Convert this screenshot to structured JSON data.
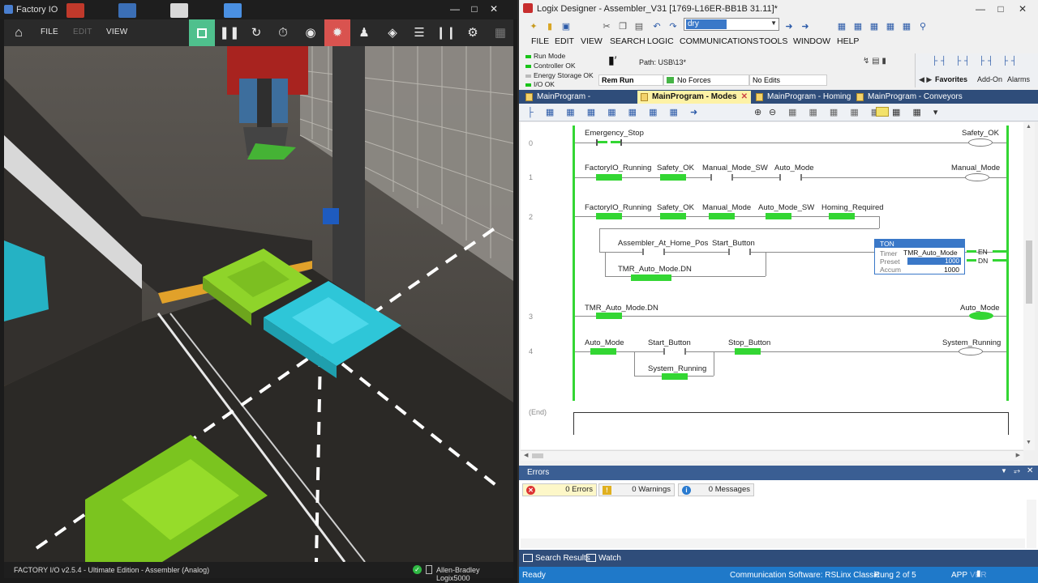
{
  "factory_io": {
    "window_title": "Factory IO",
    "menu": {
      "file": "FILE",
      "edit": "EDIT",
      "view": "VIEW"
    },
    "status_text": "FACTORY I/O v2.5.4 - Ultimate Edition - Assembler (Analog)",
    "driver_label": "Allen-Bradley Logix5000",
    "icons": [
      "home-icon",
      "edit-mode-icon",
      "pause-icon",
      "reset-icon",
      "timer-icon",
      "camera-icon",
      "sensors-icon",
      "person-icon",
      "target-icon",
      "list-icon",
      "signal-icon",
      "gears-icon",
      "grid-icon"
    ],
    "colors": {
      "accent_green": "#4fc08d",
      "accent_red": "#d9534f",
      "conveyor_yellow": "#e5a522",
      "tray_cyan": "#2ec6d8",
      "tray_green": "#8fd42a"
    }
  },
  "logix": {
    "window_title": "Logix Designer - Assembler_V31 [1769-L16ER-BB1B 31.11]*",
    "search_combo_value": "dry",
    "menu": [
      "FILE",
      "EDIT",
      "VIEW",
      "SEARCH",
      "LOGIC",
      "COMMUNICATIONS",
      "TOOLS",
      "WINDOW",
      "HELP"
    ],
    "controller_status": [
      "Run Mode",
      "Controller OK",
      "Energy Storage OK",
      "I/O OK"
    ],
    "path_label": "Path: USB\\13*",
    "mode": "Rem Run",
    "forces": "No Forces",
    "edits": "No Edits",
    "palette_tabs": [
      "Favorites",
      "Add-On",
      "Alarms"
    ],
    "tabs": [
      {
        "label": "MainProgram - Sequence_A*",
        "active": false
      },
      {
        "label": "MainProgram - Modes",
        "active": true
      },
      {
        "label": "MainProgram - Homing",
        "active": false
      },
      {
        "label": "MainProgram - Conveyors",
        "active": false
      }
    ],
    "rungs": [
      {
        "num": "0",
        "tags": [
          "Emergency_Stop"
        ],
        "coil": "Safety_OK"
      },
      {
        "num": "1",
        "tags": [
          "FactoryIO_Running",
          "Safety_OK",
          "Manual_Mode_SW",
          "Auto_Mode"
        ],
        "coil": "Manual_Mode"
      },
      {
        "num": "2",
        "tags": [
          "FactoryIO_Running",
          "Safety_OK",
          "Manual_Mode",
          "Auto_Mode_SW",
          "Homing_Required"
        ],
        "branch_tags": [
          "Assembler_At_Home_Pos",
          "Start_Button",
          "TMR_Auto_Mode.DN"
        ],
        "ton": {
          "title": "TON",
          "timer_label": "Timer",
          "timer_value": "TMR_Auto_Mode",
          "preset_label": "Preset",
          "preset_value": "1000",
          "accum_label": "Accum",
          "accum_value": "1000",
          "en": "EN",
          "dn": "DN"
        }
      },
      {
        "num": "3",
        "tags": [
          "TMR_Auto_Mode.DN"
        ],
        "coil": "Auto_Mode"
      },
      {
        "num": "4",
        "tags": [
          "Auto_Mode",
          "Start_Button",
          "Stop_Button"
        ],
        "branch_tags": [
          "System_Running"
        ],
        "coil": "System_Running"
      }
    ],
    "end_label": "(End)",
    "errors": {
      "title": "Errors",
      "errors_count": "0 Errors",
      "warnings_count": "0 Warnings",
      "messages_count": "0 Messages"
    },
    "bottom_tabs": [
      "Search Results",
      "Watch"
    ],
    "status": {
      "ready": "Ready",
      "comm": "Communication Software: RSLinx Classic",
      "rung": "Rung 2 of 5",
      "app": "APP",
      "ver": "VER"
    },
    "colors": {
      "rail_green": "#33d633",
      "tab_bar": "#2f4d7a",
      "status_blue": "#1f79c9",
      "active_tab": "#fdf2a6"
    }
  }
}
